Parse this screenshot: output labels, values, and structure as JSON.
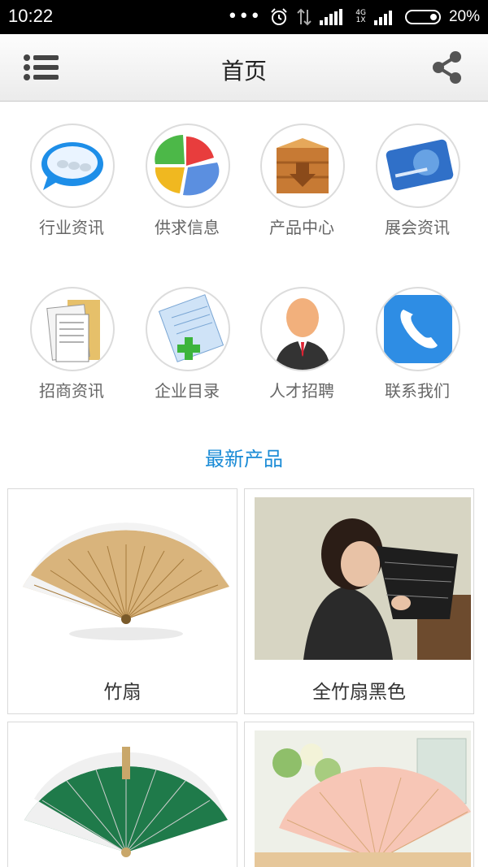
{
  "status_bar": {
    "time": "10:22",
    "dots": "•••",
    "network_top": "4G",
    "network_bottom": "1X",
    "battery": "20%"
  },
  "header": {
    "title": "首页"
  },
  "categories": [
    {
      "label": "行业资讯",
      "icon": "chat-bubble-icon"
    },
    {
      "label": "供求信息",
      "icon": "pie-chart-icon"
    },
    {
      "label": "产品中心",
      "icon": "wooden-box-icon"
    },
    {
      "label": "展会资讯",
      "icon": "credit-card-icon"
    },
    {
      "label": "招商资讯",
      "icon": "documents-icon"
    },
    {
      "label": "企业目录",
      "icon": "notepad-add-icon"
    },
    {
      "label": "人才招聘",
      "icon": "person-icon"
    },
    {
      "label": "联系我们",
      "icon": "phone-icon"
    }
  ],
  "section": {
    "title": "最新产品"
  },
  "products": [
    {
      "name": "竹扇"
    },
    {
      "name": "全竹扇黑色"
    },
    {
      "name": ""
    },
    {
      "name": ""
    }
  ]
}
